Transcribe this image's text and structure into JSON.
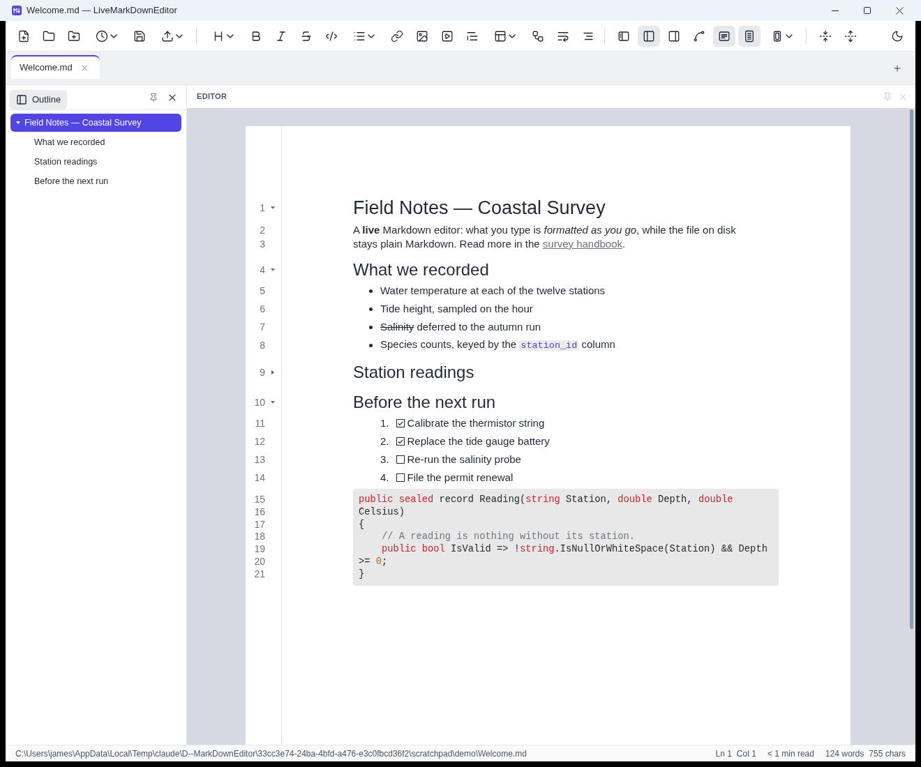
{
  "window": {
    "title": "Welcome.md — LiveMarkDownEditor"
  },
  "toolbar": {
    "groups": [
      [
        {
          "dropdown": false,
          "selected": false
        },
        {
          "dropdown": false,
          "selected": false
        },
        {
          "dropdown": false,
          "selected": false
        },
        {
          "dropdown": true,
          "selected": false
        },
        {
          "dropdown": false,
          "selected": false
        },
        {
          "dropdown": true,
          "selected": false
        }
      ],
      [
        {
          "dropdown": true,
          "selected": false
        },
        {
          "dropdown": false,
          "selected": false
        },
        {
          "dropdown": false,
          "selected": false
        },
        {
          "dropdown": false,
          "selected": false
        },
        {
          "dropdown": false,
          "selected": false
        },
        {
          "dropdown": true,
          "selected": false
        },
        {
          "dropdown": false,
          "selected": false
        },
        {
          "dropdown": false,
          "selected": false
        },
        {
          "dropdown": false,
          "selected": false
        },
        {
          "dropdown": false,
          "selected": false
        },
        {
          "dropdown": true,
          "selected": false
        },
        {
          "dropdown": false,
          "selected": false
        },
        {
          "dropdown": false,
          "selected": false
        },
        {
          "dropdown": false,
          "selected": false
        }
      ],
      [
        {
          "dropdown": false,
          "selected": false
        },
        {
          "dropdown": false,
          "selected": true
        },
        {
          "dropdown": false,
          "selected": false
        },
        {
          "dropdown": false,
          "selected": false
        },
        {
          "dropdown": false,
          "selected": true
        },
        {
          "dropdown": false,
          "selected": true
        },
        {
          "dropdown": true,
          "selected": false
        }
      ],
      [
        {
          "dropdown": false,
          "selected": false
        },
        {
          "dropdown": false,
          "selected": false
        }
      ]
    ],
    "end": [
      {
        "dropdown": false,
        "selected": false
      }
    ]
  },
  "tabs": [
    {
      "label": "Welcome.md",
      "selected": true
    }
  ],
  "outline": {
    "title": "Outline",
    "items": [
      {
        "label": "Field Notes — Coastal Survey",
        "selected": true,
        "expanded": true,
        "children": [
          {
            "label": "What we recorded",
            "selected": false
          },
          {
            "label": "Station readings",
            "selected": false
          },
          {
            "label": "Before the next run",
            "selected": false
          }
        ]
      }
    ]
  },
  "editor": {
    "title": "EDITOR",
    "document": [
      {
        "kind": "heading1",
        "line": "1",
        "folded": false,
        "text": "Field Notes — Coastal Survey"
      },
      {
        "kind": "paragraph",
        "lines": [
          "2",
          "3"
        ],
        "segments": [
          {
            "kind": "text",
            "text": "A **live** Markdown editor: what you type is *formatted as you go*, while the file on disk stays plain Markdown. Read more in the "
          },
          {
            "kind": "link",
            "text": "survey handbook"
          },
          {
            "kind": "text",
            "text": "."
          }
        ]
      },
      {
        "kind": "heading2",
        "line": "4",
        "folded": false,
        "text": "What we recorded"
      },
      {
        "kind": "bullet",
        "line": "5",
        "segments": [
          {
            "kind": "text",
            "text": "Water temperature at each of the twelve stations"
          }
        ]
      },
      {
        "kind": "bullet",
        "line": "6",
        "segments": [
          {
            "kind": "text",
            "text": "Tide height, sampled on the hour"
          }
        ]
      },
      {
        "kind": "bullet",
        "line": "7",
        "segments": [
          {
            "kind": "strike",
            "text": "Salinity"
          },
          {
            "kind": "text",
            "text": " deferred to the autumn run"
          }
        ]
      },
      {
        "kind": "bullet",
        "line": "8",
        "segments": [
          {
            "kind": "text",
            "text": "Species counts, keyed by the "
          },
          {
            "kind": "code",
            "text": "station_id"
          },
          {
            "kind": "text",
            "text": " column"
          }
        ]
      },
      {
        "kind": "heading2",
        "line": "9",
        "folded": true,
        "text": "Station readings"
      },
      {
        "kind": "heading2",
        "line": "10",
        "folded": false,
        "text": "Before the next run"
      },
      {
        "kind": "task",
        "line": "11",
        "number": "1.",
        "checked": true,
        "text": "Calibrate the thermistor string"
      },
      {
        "kind": "task",
        "line": "12",
        "number": "2.",
        "checked": true,
        "text": "Replace the tide gauge battery"
      },
      {
        "kind": "task",
        "line": "13",
        "number": "3.",
        "checked": false,
        "text": "Re-run the salinity probe"
      },
      {
        "kind": "task",
        "line": "14",
        "number": "4.",
        "checked": false,
        "text": "File the permit renewal"
      },
      {
        "kind": "code",
        "lines": [
          {
            "line": "15",
            "tokens": [
              {
                "kind": "keyword",
                "text": "public sealed"
              },
              {
                "kind": "plain",
                "text": " record Reading("
              },
              {
                "kind": "keyword",
                "text": "string"
              },
              {
                "kind": "plain",
                "text": " Station, "
              },
              {
                "kind": "keyword",
                "text": "double"
              },
              {
                "kind": "plain",
                "text": " Depth, "
              },
              {
                "kind": "keyword",
                "text": "double"
              }
            ]
          },
          {
            "line": "16",
            "tokens": [
              {
                "kind": "plain",
                "text": "Celsius)"
              }
            ]
          },
          {
            "line": "17",
            "tokens": [
              {
                "kind": "plain",
                "text": "{"
              }
            ]
          },
          {
            "line": "18",
            "tokens": [
              {
                "kind": "comment",
                "text": "    // A reading is nothing without its station."
              }
            ]
          },
          {
            "line": "19",
            "tokens": [
              {
                "kind": "keyword",
                "text": "    public bool"
              },
              {
                "kind": "plain",
                "text": " IsValid => !"
              },
              {
                "kind": "keyword",
                "text": "string"
              },
              {
                "kind": "plain",
                "text": ".IsNullOrWhiteSpace(Station) && Depth"
              }
            ]
          },
          {
            "line": "20",
            "tokens": [
              {
                "kind": "plain",
                "text": ">= "
              },
              {
                "kind": "number",
                "text": "0"
              },
              {
                "kind": "plain",
                "text": ";"
              }
            ]
          },
          {
            "line": "21",
            "tokens": [
              {
                "kind": "plain",
                "text": "}"
              }
            ]
          }
        ]
      }
    ]
  },
  "status_bar": {
    "path": "C:\\Users\\james\\AppData\\Local\\Temp\\claude\\D--MarkDownEditor\\33cc3e74-24ba-4bfd-a476-e3c0fbcd36f2\\scratchpad\\demo\\Welcome.md",
    "groups": [
      [
        "Ln 1",
        "Col 1"
      ],
      [
        "< 1 min read"
      ],
      [
        "124 words",
        "755 chars"
      ]
    ]
  }
}
